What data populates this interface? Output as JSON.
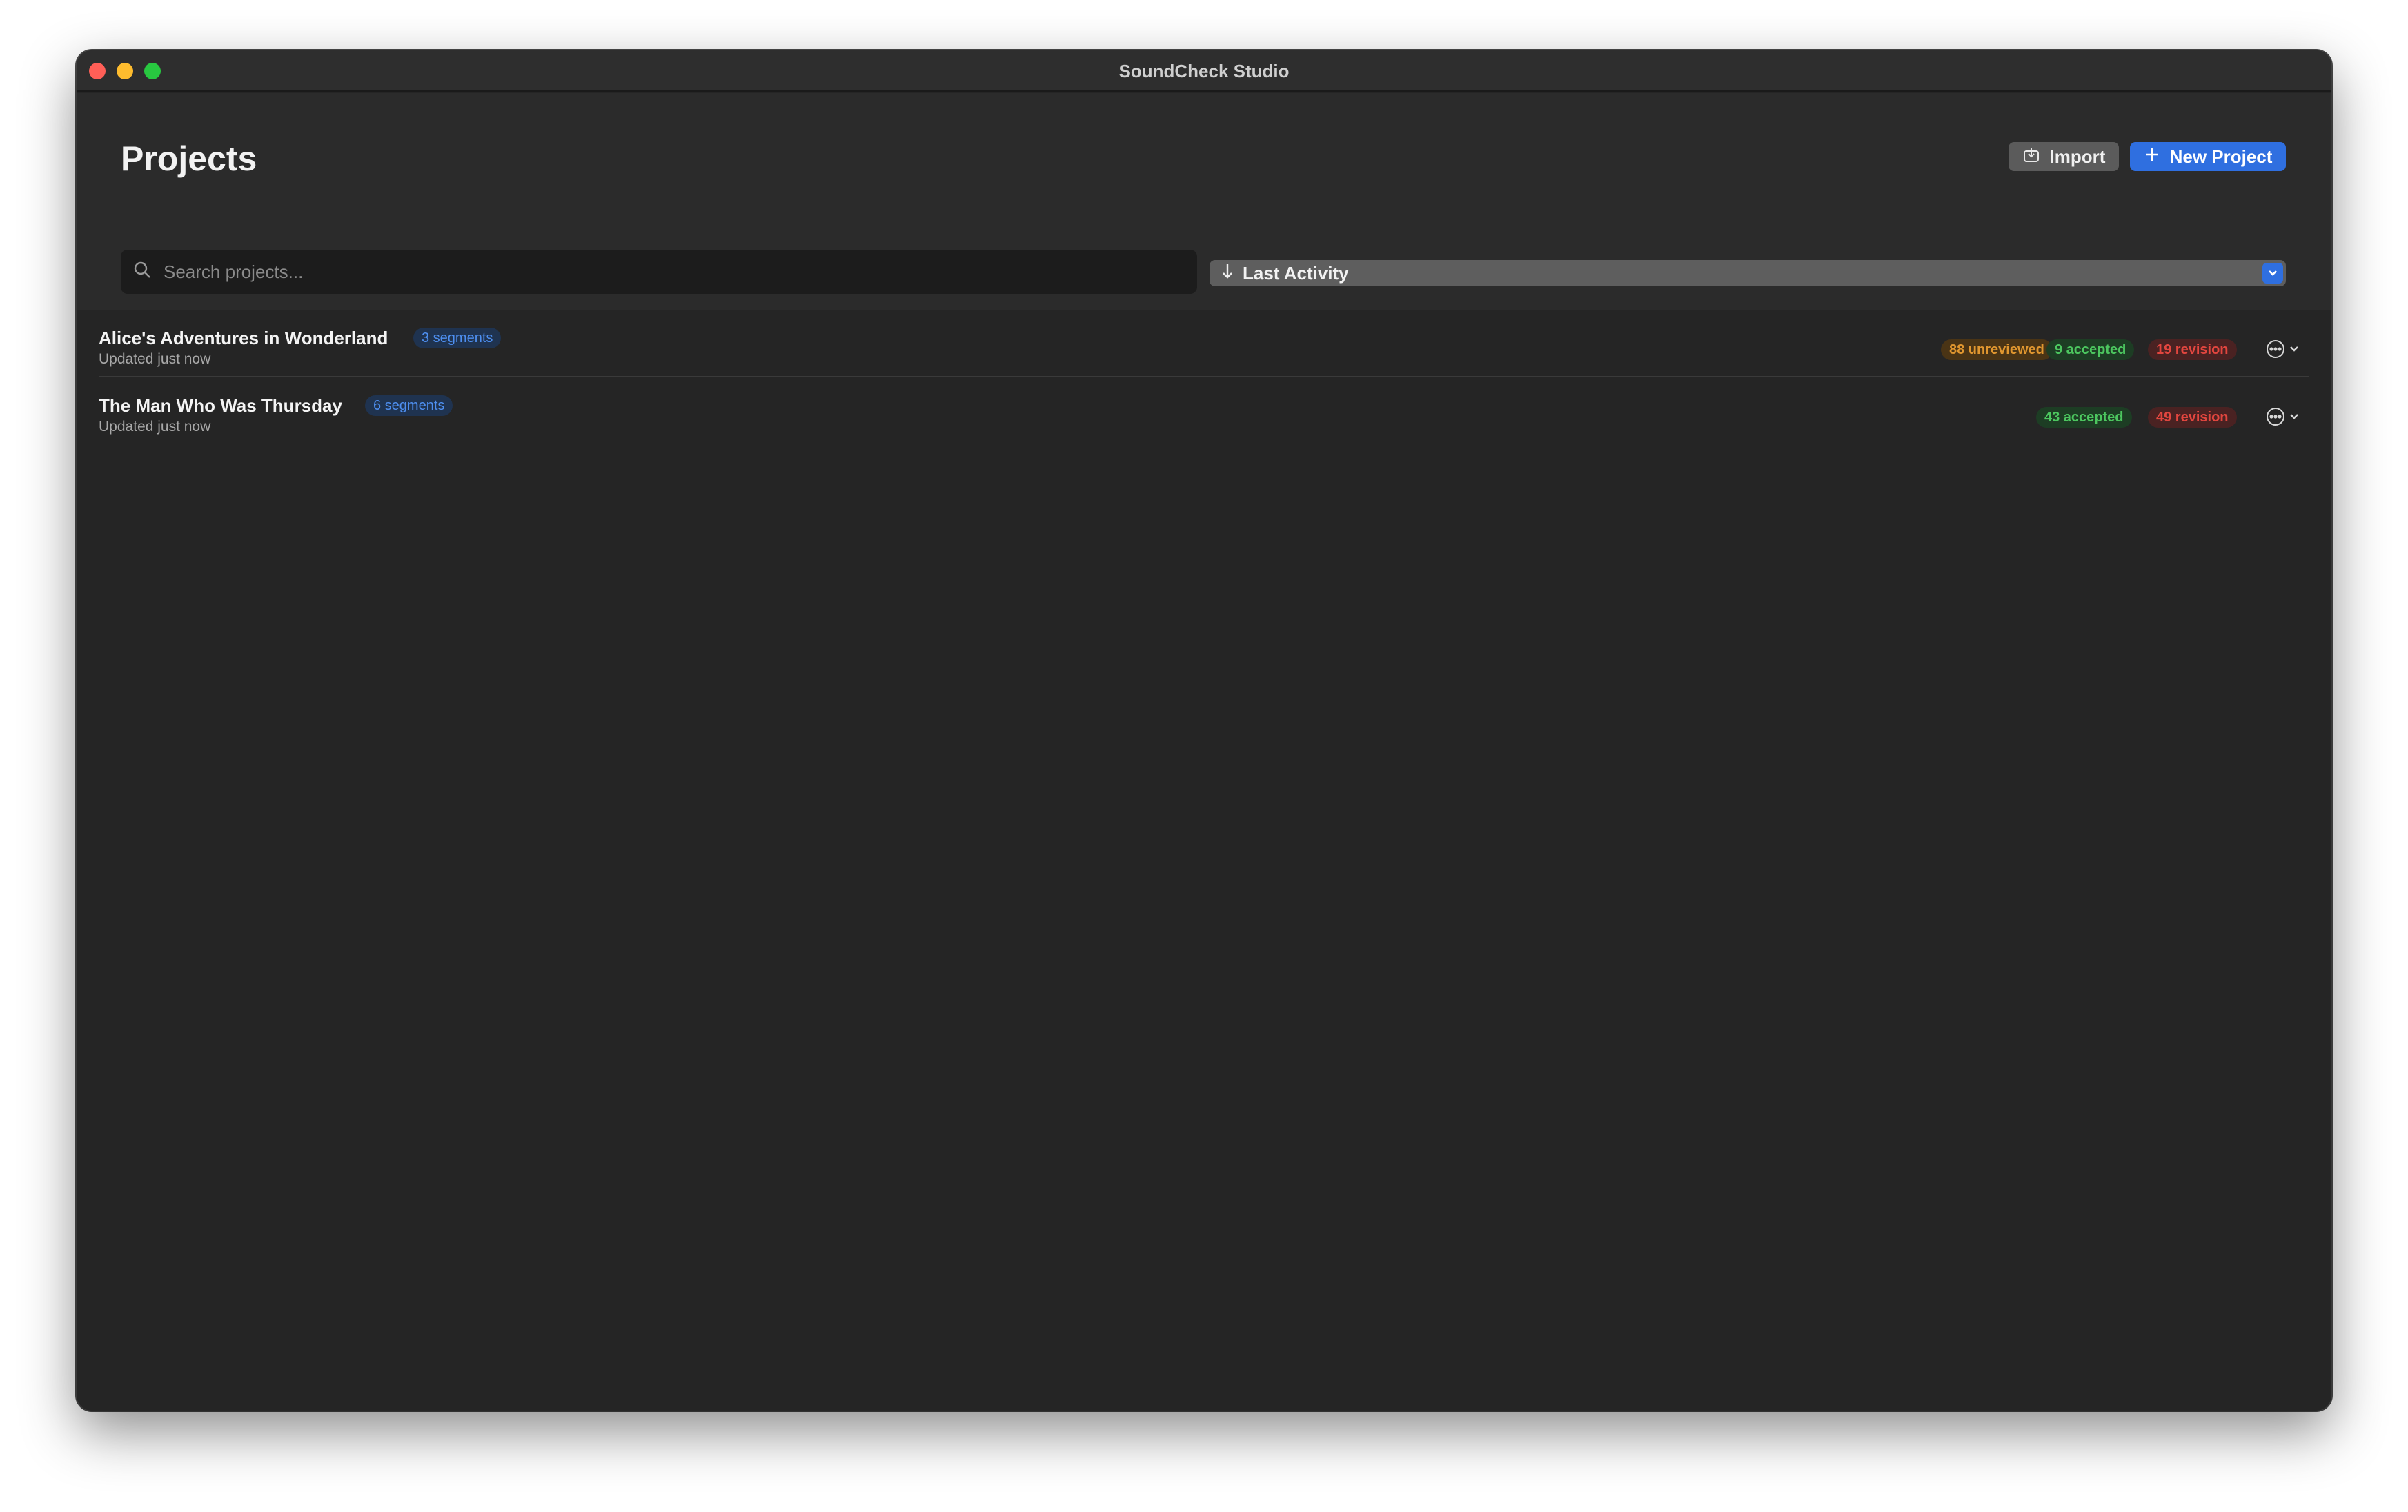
{
  "window": {
    "title": "SoundCheck Studio"
  },
  "header": {
    "title": "Projects",
    "import_label": "Import",
    "new_project_label": "New Project",
    "search_placeholder": "Search projects...",
    "sort_label": "Last Activity"
  },
  "projects": [
    {
      "title": "Alice's Adventures in Wonderland",
      "segments": "3 segments",
      "updated": "Updated just now",
      "unreviewed": "88 unreviewed",
      "accepted": "9 accepted",
      "revision": "19 revision"
    },
    {
      "title": "The Man Who Was Thursday",
      "segments": "6 segments",
      "updated": "Updated just now",
      "accepted": "43 accepted",
      "revision": "49 revision"
    }
  ],
  "colors": {
    "accent": "#2f6fe0",
    "unreviewed": "#e0962f",
    "accepted": "#4cc65f",
    "revision": "#e2463f"
  }
}
